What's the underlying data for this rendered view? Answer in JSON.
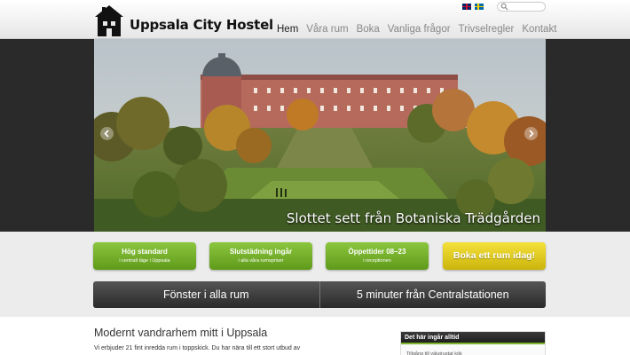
{
  "header": {
    "logo_text": "Uppsala City Hostel",
    "search": {
      "placeholder": ""
    },
    "languages": [
      "gb-flag-icon",
      "se-flag-icon"
    ],
    "nav": [
      {
        "label": "Hem",
        "active": true
      },
      {
        "label": "Våra rum",
        "active": false
      },
      {
        "label": "Boka",
        "active": false
      },
      {
        "label": "Vanliga frågor",
        "active": false
      },
      {
        "label": "Trivselregler",
        "active": false
      },
      {
        "label": "Kontakt",
        "active": false
      }
    ]
  },
  "hero": {
    "caption": "Slottet sett från Botaniska Trädgården",
    "prev_icon": "chevron-left-icon",
    "next_icon": "chevron-right-icon"
  },
  "features": [
    {
      "title": "Hög standard",
      "subtitle": "i centralt läge i Uppsala"
    },
    {
      "title": "Slutstädning ingår",
      "subtitle": "i alla våra rumspriser"
    },
    {
      "title": "Öppettider 08–23",
      "subtitle": "i receptionen"
    }
  ],
  "cta": {
    "label": "Boka ett rum idag!"
  },
  "bar": {
    "left": "Fönster i alla rum",
    "right": "5 minuter från Centralstationen"
  },
  "main": {
    "heading": "Modernt vandrarhem mitt i Uppsala",
    "intro": "Vi erbjuder 21 fint inredda rum i toppskick. Du har nära till ett stort utbud av"
  },
  "sidebar": {
    "heading": "Det här ingår alltid",
    "items": [
      "Tillgång till välutrustat kök"
    ]
  },
  "colors": {
    "green": "#6fac24",
    "yellow": "#e0c91d",
    "dark": "#2a2a2a",
    "accent_line": "#7fb52c"
  }
}
